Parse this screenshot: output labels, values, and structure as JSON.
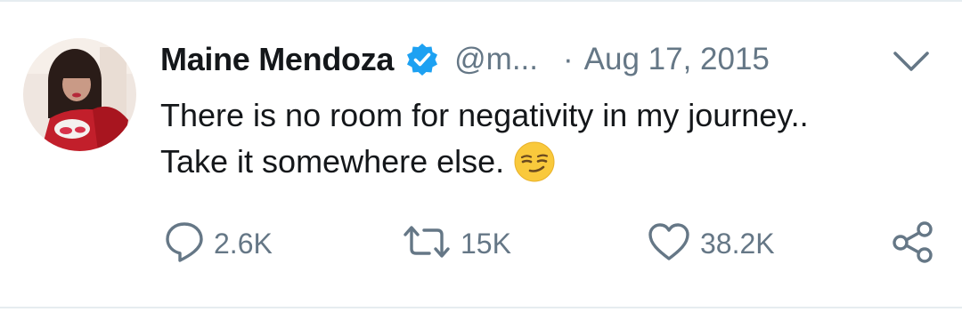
{
  "tweet": {
    "author_name": "Maine Mendoza",
    "verified": true,
    "handle": "@m...",
    "separator": "·",
    "date": "Aug 17, 2015",
    "body_lines": [
      "There is no room for negativity in my journey..",
      "Take it somewhere else."
    ],
    "emoji": "smirking-face-emoji",
    "stats": {
      "replies": "2.6K",
      "retweets": "15K",
      "likes": "38.2K"
    }
  },
  "icons": {
    "verified": "verified-badge-icon",
    "caret": "chevron-down-icon",
    "reply": "reply-icon",
    "retweet": "retweet-icon",
    "like": "heart-icon",
    "share": "share-icon"
  },
  "colors": {
    "text_primary": "#14171a",
    "text_secondary": "#657786",
    "verified_blue": "#1da1f2",
    "divider": "#e6ecf0"
  }
}
